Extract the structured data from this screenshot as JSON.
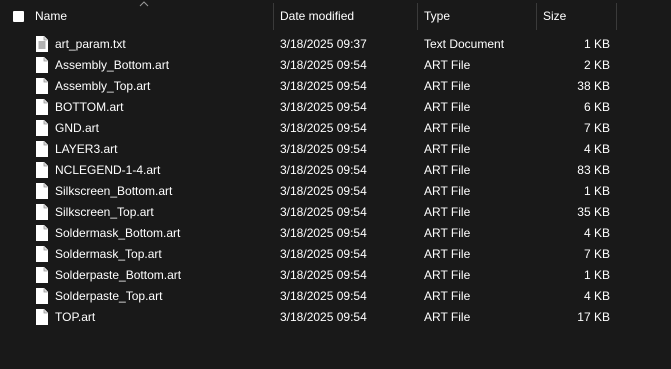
{
  "columns": {
    "name": "Name",
    "date": "Date modified",
    "type": "Type",
    "size": "Size"
  },
  "files": [
    {
      "name": "art_param.txt",
      "date": "3/18/2025 09:37",
      "type": "Text Document",
      "size": "1 KB",
      "icon": "text-document-icon"
    },
    {
      "name": "Assembly_Bottom.art",
      "date": "3/18/2025 09:54",
      "type": "ART File",
      "size": "2 KB",
      "icon": "file-icon"
    },
    {
      "name": "Assembly_Top.art",
      "date": "3/18/2025 09:54",
      "type": "ART File",
      "size": "38 KB",
      "icon": "file-icon"
    },
    {
      "name": "BOTTOM.art",
      "date": "3/18/2025 09:54",
      "type": "ART File",
      "size": "6 KB",
      "icon": "file-icon"
    },
    {
      "name": "GND.art",
      "date": "3/18/2025 09:54",
      "type": "ART File",
      "size": "7 KB",
      "icon": "file-icon"
    },
    {
      "name": "LAYER3.art",
      "date": "3/18/2025 09:54",
      "type": "ART File",
      "size": "4 KB",
      "icon": "file-icon"
    },
    {
      "name": "NCLEGEND-1-4.art",
      "date": "3/18/2025 09:54",
      "type": "ART File",
      "size": "83 KB",
      "icon": "file-icon"
    },
    {
      "name": "Silkscreen_Bottom.art",
      "date": "3/18/2025 09:54",
      "type": "ART File",
      "size": "1 KB",
      "icon": "file-icon"
    },
    {
      "name": "Silkscreen_Top.art",
      "date": "3/18/2025 09:54",
      "type": "ART File",
      "size": "35 KB",
      "icon": "file-icon"
    },
    {
      "name": "Soldermask_Bottom.art",
      "date": "3/18/2025 09:54",
      "type": "ART File",
      "size": "4 KB",
      "icon": "file-icon"
    },
    {
      "name": "Soldermask_Top.art",
      "date": "3/18/2025 09:54",
      "type": "ART File",
      "size": "7 KB",
      "icon": "file-icon"
    },
    {
      "name": "Solderpaste_Bottom.art",
      "date": "3/18/2025 09:54",
      "type": "ART File",
      "size": "1 KB",
      "icon": "file-icon"
    },
    {
      "name": "Solderpaste_Top.art",
      "date": "3/18/2025 09:54",
      "type": "ART File",
      "size": "4 KB",
      "icon": "file-icon"
    },
    {
      "name": "TOP.art",
      "date": "3/18/2025 09:54",
      "type": "ART File",
      "size": "17 KB",
      "icon": "file-icon"
    }
  ],
  "colors": {
    "background": "#191919",
    "text": "#ffffff",
    "separator": "#3a3a3a"
  }
}
